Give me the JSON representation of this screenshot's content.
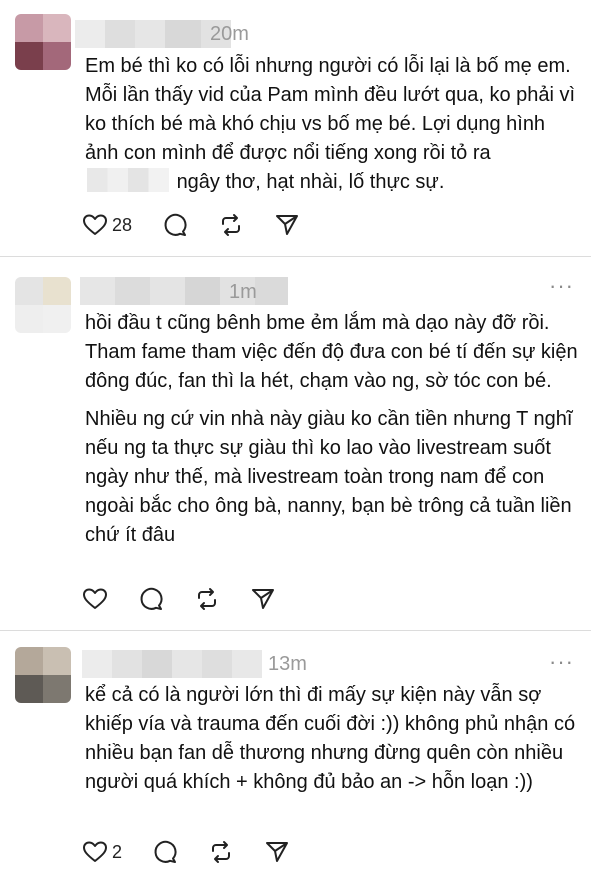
{
  "comments": [
    {
      "time": "20m",
      "text_parts": [
        "Em bé thì ko có lỗi nhưng người có lỗi lại là bố mẹ em. Mỗi lần thấy vid của Pam mình đều lướt qua, ko phải vì ko thích bé mà khó chịu vs bố mẹ bé. Lợi dụng hình ảnh con mình để được nổi tiếng xong rồi tỏ ra",
        "ngây thơ, hạt nhài, lố thực sự."
      ],
      "likes": "28"
    },
    {
      "time": "1m",
      "paragraphs": [
        "hồi đầu t cũng bênh bme ẻm lắm mà dạo này đỡ rồi. Tham fame tham việc đến độ đưa con bé tí đến sự kiện đông đúc, fan thì la hét, chạm vào ng, sờ tóc con bé.",
        "Nhiều ng cứ vin nhà này giàu ko cần tiền nhưng T nghĩ nếu ng ta thực sự giàu thì ko lao vào livestream suốt ngày như thế, mà livestream toàn trong nam để con ngoài bắc cho ông bà, nanny, bạn bè trông cả tuần liền chứ ít đâu"
      ]
    },
    {
      "time": "13m",
      "text": "kể cả có là người lớn thì đi mấy sự kiện này vẫn sợ khiếp vía và trauma đến cuối đời :)) không phủ nhận có nhiều bạn fan dễ thương nhưng đừng quên còn nhiều người quá khích + không đủ bảo an -> hỗn loạn :))",
      "likes": "2"
    }
  ],
  "more_glyph": "···",
  "icons": [
    "heart-icon",
    "comment-icon",
    "repost-icon",
    "share-icon"
  ]
}
